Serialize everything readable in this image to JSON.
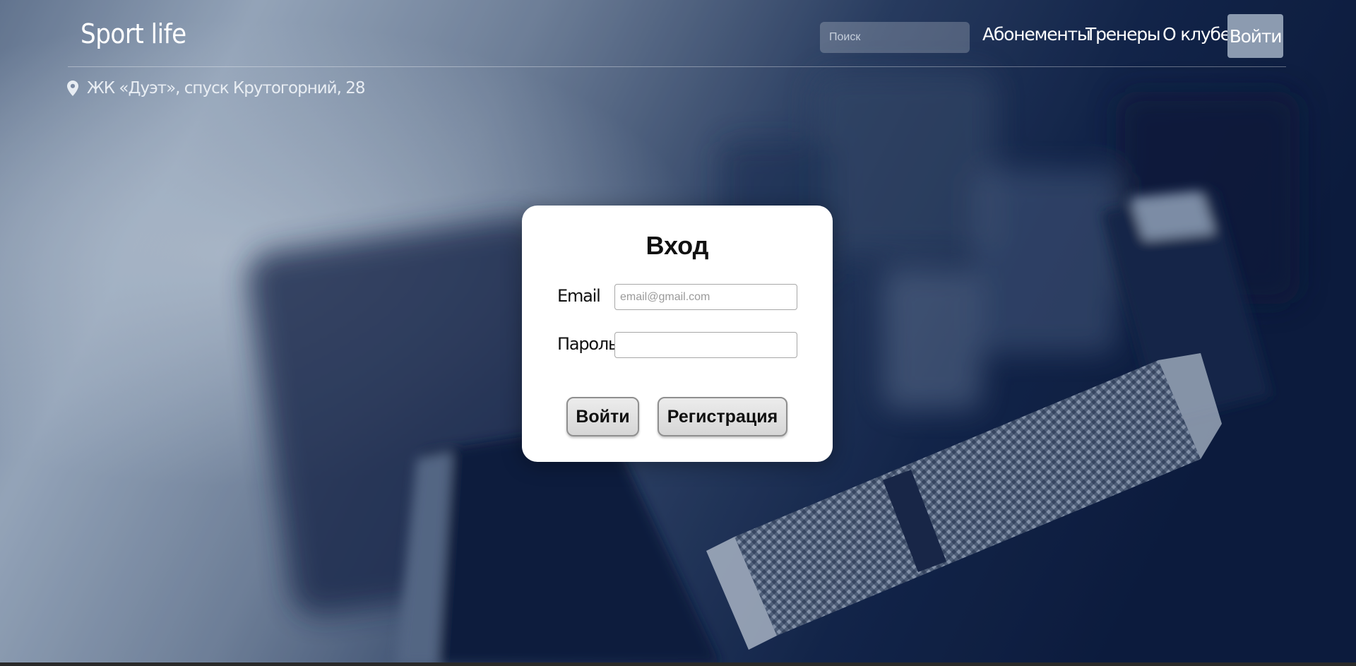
{
  "header": {
    "brand": "Sport life",
    "search_placeholder": "Поиск",
    "nav": [
      {
        "label": "Абонементы"
      },
      {
        "label": "Тренеры"
      },
      {
        "label": "О клубе"
      }
    ],
    "login_label": "Войти"
  },
  "address": {
    "icon": "map-pin-icon",
    "text": "ЖК «Дуэт», спуск Крутогорний, 28"
  },
  "login_form": {
    "title": "Вход",
    "email_label": "Email",
    "email_placeholder": "email@gmail.com",
    "email_value": "",
    "password_label": "Пароль",
    "password_value": "",
    "submit_label": "Войти",
    "register_label": "Регистрация"
  },
  "colors": {
    "overlay_dark": "#0d1d3f",
    "overlay_light": "#a9b9cc",
    "card": "#ffffff",
    "nav_login_bg": "#8c9bb0"
  }
}
